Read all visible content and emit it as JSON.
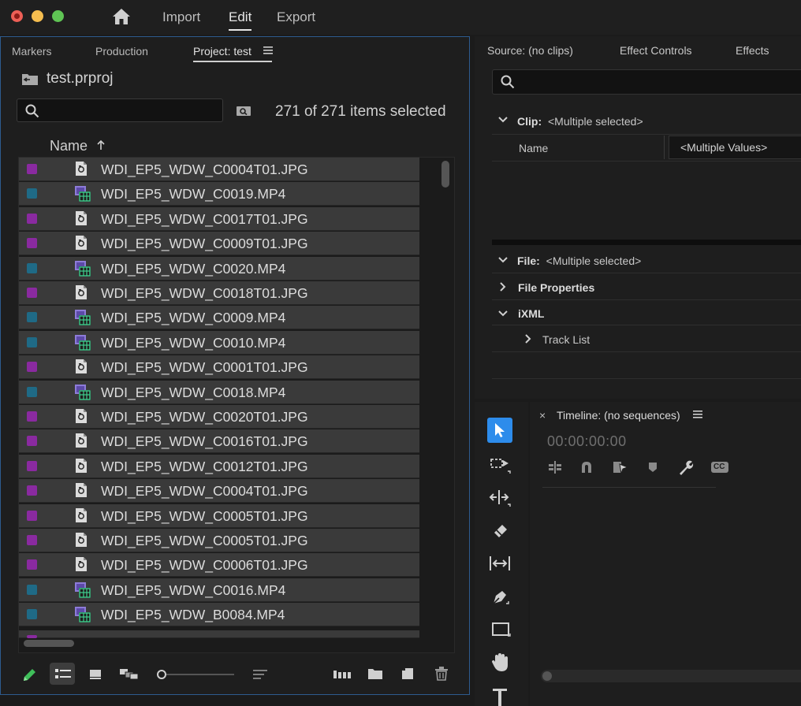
{
  "title_bar": {
    "menu": [
      {
        "label": "Import"
      },
      {
        "label": "Edit",
        "active": true
      },
      {
        "label": "Export"
      }
    ]
  },
  "project_panel": {
    "tabs": [
      "Markers",
      "Production",
      "Project: test"
    ],
    "active_tab": "Project: test",
    "project_file": "test.prproj",
    "search": {
      "value": "",
      "placeholder": ""
    },
    "selection_status": "271 of 271 items selected",
    "column_header": "Name",
    "sort_direction": "ascending",
    "items": [
      {
        "name": "WDI_EP5_WDW_C0004T01.JPG",
        "type": "image",
        "label_color": "#8a2aa0"
      },
      {
        "name": "WDI_EP5_WDW_C0019.MP4",
        "type": "video",
        "label_color": "#1f6a86"
      },
      {
        "name": "WDI_EP5_WDW_C0017T01.JPG",
        "type": "image",
        "label_color": "#8a2aa0"
      },
      {
        "name": "WDI_EP5_WDW_C0009T01.JPG",
        "type": "image",
        "label_color": "#8a2aa0"
      },
      {
        "name": "WDI_EP5_WDW_C0020.MP4",
        "type": "video",
        "label_color": "#1f6a86"
      },
      {
        "name": "WDI_EP5_WDW_C0018T01.JPG",
        "type": "image",
        "label_color": "#8a2aa0"
      },
      {
        "name": "WDI_EP5_WDW_C0009.MP4",
        "type": "video",
        "label_color": "#1f6a86"
      },
      {
        "name": "WDI_EP5_WDW_C0010.MP4",
        "type": "video",
        "label_color": "#1f6a86"
      },
      {
        "name": "WDI_EP5_WDW_C0001T01.JPG",
        "type": "image",
        "label_color": "#8a2aa0"
      },
      {
        "name": "WDI_EP5_WDW_C0018.MP4",
        "type": "video",
        "label_color": "#1f6a86"
      },
      {
        "name": "WDI_EP5_WDW_C0020T01.JPG",
        "type": "image",
        "label_color": "#8a2aa0"
      },
      {
        "name": "WDI_EP5_WDW_C0016T01.JPG",
        "type": "image",
        "label_color": "#8a2aa0"
      },
      {
        "name": "WDI_EP5_WDW_C0012T01.JPG",
        "type": "image",
        "label_color": "#8a2aa0"
      },
      {
        "name": "WDI_EP5_WDW_C0004T01.JPG",
        "type": "image",
        "label_color": "#8a2aa0"
      },
      {
        "name": "WDI_EP5_WDW_C0005T01.JPG",
        "type": "image",
        "label_color": "#8a2aa0"
      },
      {
        "name": "WDI_EP5_WDW_C0005T01.JPG",
        "type": "image",
        "label_color": "#8a2aa0"
      },
      {
        "name": "WDI_EP5_WDW_C0006T01.JPG",
        "type": "image",
        "label_color": "#8a2aa0"
      },
      {
        "name": "WDI_EP5_WDW_C0016.MP4",
        "type": "video",
        "label_color": "#1f6a86"
      },
      {
        "name": "WDI_EP5_WDW_B0084.MP4",
        "type": "video",
        "label_color": "#1f6a86"
      }
    ],
    "bottom_toolbar_icons": [
      "pencil-icon",
      "list-view-icon",
      "icon-view-icon",
      "freeform-view-icon",
      "zoom-slider",
      "sort-icon",
      "automate-to-sequence-icon",
      "new-bin-icon",
      "new-item-icon",
      "trash-icon"
    ]
  },
  "metadata_panel": {
    "tabs": [
      "Source: (no clips)",
      "Effect Controls",
      "Effects"
    ],
    "search": {
      "value": "",
      "placeholder": ""
    },
    "clip_section": {
      "label": "Clip:",
      "value": "<Multiple selected>"
    },
    "name_row": {
      "label": "Name",
      "value": "<Multiple Values>"
    },
    "file_section": {
      "label": "File:",
      "value": "<Multiple selected>"
    },
    "file_properties": "File Properties",
    "ixml": "iXML",
    "track_list": "Track List"
  },
  "timeline": {
    "title": "Timeline: (no sequences)",
    "timecode": "00:00:00:00",
    "close_label": "×",
    "cc_label": "CC"
  },
  "tools": [
    "selection-tool-icon",
    "track-select-tool-icon",
    "ripple-edit-tool-icon",
    "razor-tool-icon",
    "slip-tool-icon",
    "pen-tool-icon",
    "rectangle-tool-icon",
    "hand-tool-icon",
    "type-tool-icon"
  ],
  "colors": {
    "accent_blue": "#2d8ceb",
    "panel_bg": "#1e1e1e",
    "row_bg": "#3a3a3a",
    "image_label": "#8a2aa0",
    "video_label": "#1f6a86"
  }
}
